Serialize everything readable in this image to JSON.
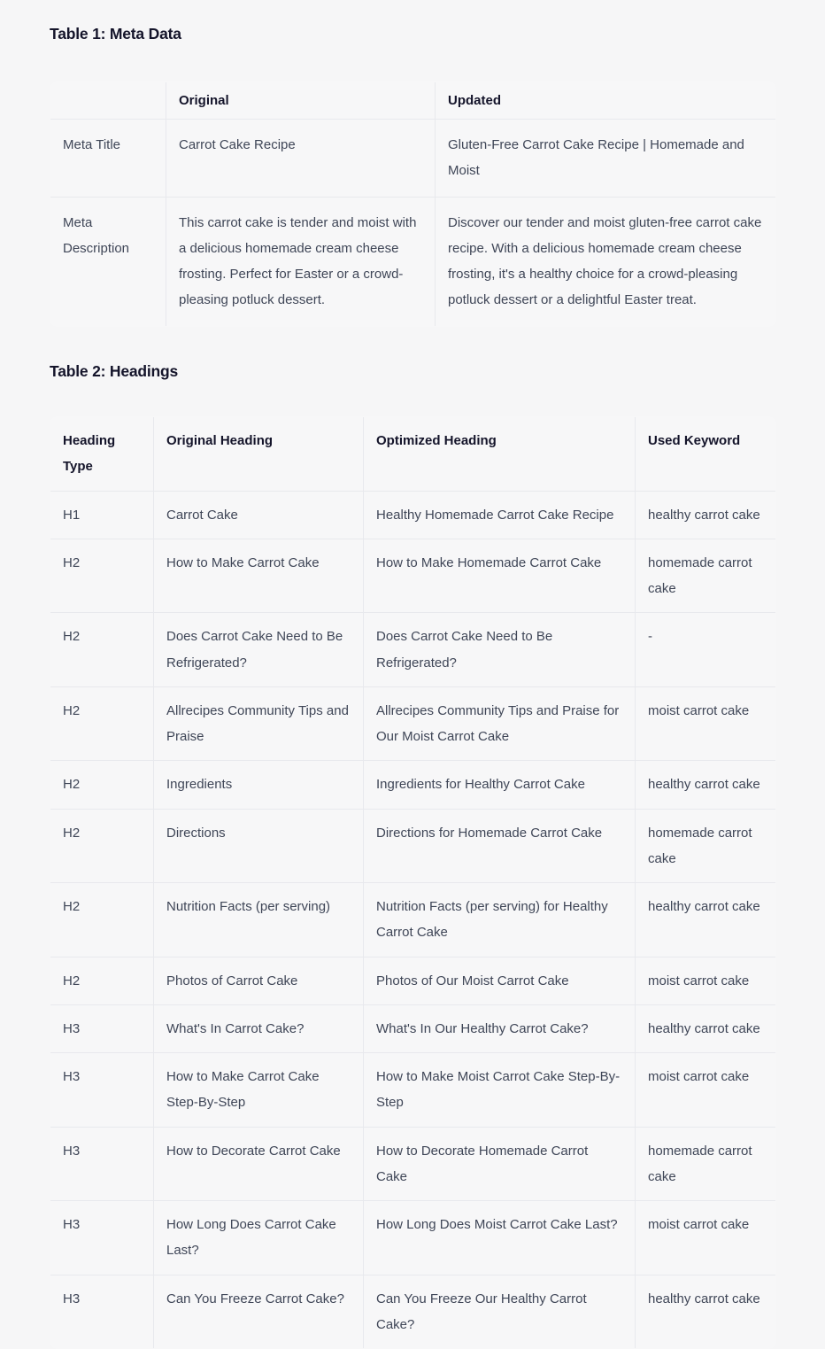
{
  "table1": {
    "title": "Table 1: Meta Data",
    "headers": [
      "",
      "Original",
      "Updated"
    ],
    "rows": [
      {
        "label": "Meta Title",
        "original": "Carrot Cake Recipe",
        "updated": "Gluten-Free Carrot Cake Recipe | Homemade and Moist"
      },
      {
        "label": "Meta Description",
        "original": "This carrot cake is tender and moist with a delicious homemade cream cheese frosting. Perfect for Easter or a crowd-pleasing potluck dessert.",
        "updated": "Discover our tender and moist gluten-free carrot cake recipe. With a delicious homemade cream cheese frosting, it's a healthy choice for a crowd-pleasing potluck dessert or a delightful Easter treat."
      }
    ]
  },
  "table2": {
    "title": "Table 2: Headings",
    "headers": [
      "Heading Type",
      "Original Heading",
      "Optimized Heading",
      "Used Keyword"
    ],
    "rows": [
      {
        "type": "H1",
        "original": "Carrot Cake",
        "optimized": "Healthy Homemade Carrot Cake Recipe",
        "keyword": "healthy carrot cake"
      },
      {
        "type": "H2",
        "original": "How to Make Carrot Cake",
        "optimized": "How to Make Homemade Carrot Cake",
        "keyword": "homemade carrot cake"
      },
      {
        "type": "H2",
        "original": "Does Carrot Cake Need to Be Refrigerated?",
        "optimized": "Does Carrot Cake Need to Be Refrigerated?",
        "keyword": "-"
      },
      {
        "type": "H2",
        "original": "Allrecipes Community Tips and Praise",
        "optimized": "Allrecipes Community Tips and Praise for Our Moist Carrot Cake",
        "keyword": "moist carrot cake"
      },
      {
        "type": "H2",
        "original": "Ingredients",
        "optimized": "Ingredients for Healthy Carrot Cake",
        "keyword": "healthy carrot cake"
      },
      {
        "type": "H2",
        "original": "Directions",
        "optimized": "Directions for Homemade Carrot Cake",
        "keyword": "homemade carrot cake"
      },
      {
        "type": "H2",
        "original": "Nutrition Facts (per serving)",
        "optimized": "Nutrition Facts (per serving) for Healthy Carrot Cake",
        "keyword": "healthy carrot cake"
      },
      {
        "type": "H2",
        "original": "Photos of Carrot Cake",
        "optimized": "Photos of Our Moist Carrot Cake",
        "keyword": "moist carrot cake"
      },
      {
        "type": "H3",
        "original": "What's In Carrot Cake?",
        "optimized": "What's In Our Healthy Carrot Cake?",
        "keyword": "healthy carrot cake"
      },
      {
        "type": "H3",
        "original": "How to Make Carrot Cake Step-By-Step",
        "optimized": "How to Make Moist Carrot Cake Step-By-Step",
        "keyword": "moist carrot cake"
      },
      {
        "type": "H3",
        "original": "How to Decorate Carrot Cake",
        "optimized": "How to Decorate Homemade Carrot Cake",
        "keyword": "homemade carrot cake"
      },
      {
        "type": "H3",
        "original": "How Long Does Carrot Cake Last?",
        "optimized": "How Long Does Moist Carrot Cake Last?",
        "keyword": "moist carrot cake"
      },
      {
        "type": "H3",
        "original": "Can You Freeze Carrot Cake?",
        "optimized": "Can You Freeze Our Healthy Carrot Cake?",
        "keyword": "healthy carrot cake"
      }
    ]
  },
  "colors": {
    "page_background": "#f6f6f7",
    "table_background": "#f7f7f8",
    "border": "#e8e9ed",
    "body_text": "#3f4657",
    "heading_text": "#14142a"
  }
}
